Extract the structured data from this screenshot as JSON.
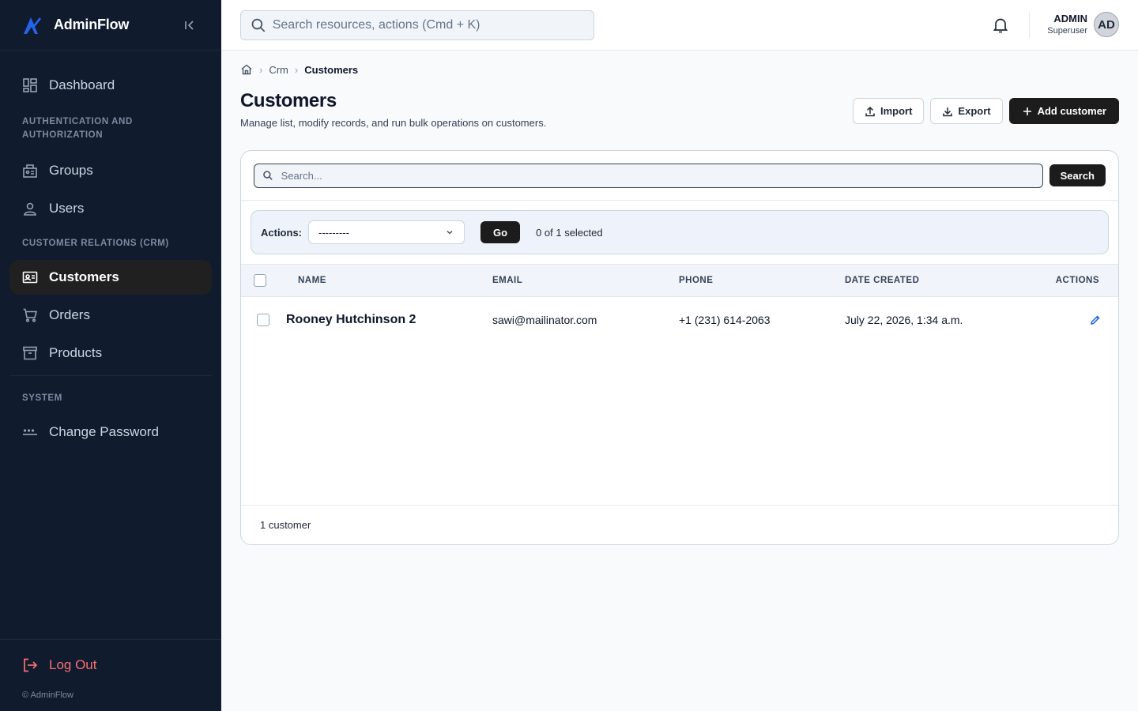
{
  "app": {
    "name": "AdminFlow",
    "copyright": "© AdminFlow"
  },
  "sidebar": {
    "dashboard": "Dashboard",
    "section_auth": "Authentication and Authorization",
    "groups": "Groups",
    "users": "Users",
    "section_crm": "Customer Relations (CRM)",
    "customers": "Customers",
    "orders": "Orders",
    "products": "Products",
    "section_system": "System",
    "change_password": "Change Password",
    "logout": "Log Out"
  },
  "topbar": {
    "search_placeholder": "Search resources, actions (Cmd + K)",
    "user_name": "ADMIN",
    "user_role": "Superuser",
    "avatar_initials": "AD"
  },
  "breadcrumb": {
    "level1": "Crm",
    "current": "Customers",
    "separator": "›"
  },
  "page": {
    "title": "Customers",
    "subtitle": "Manage list, modify records, and run bulk operations on customers.",
    "import_label": "Import",
    "export_label": "Export",
    "add_label": "Add customer"
  },
  "list": {
    "search_placeholder": "Search...",
    "search_button": "Search",
    "actions_label": "Actions:",
    "actions_selected": "---------",
    "go_button": "Go",
    "selected_count": "0 of 1 selected",
    "columns": {
      "name": "NAME",
      "email": "EMAIL",
      "phone": "PHONE",
      "date": "DATE CREATED",
      "actions": "ACTIONS"
    },
    "rows": [
      {
        "name": "Rooney Hutchinson 2",
        "email": "sawi@mailinator.com",
        "phone": "+1 (231) 614-2063",
        "date": "July 22, 2026, 1:34 a.m."
      }
    ],
    "footer": "1 customer"
  },
  "colors": {
    "sidebar_bg": "#111b2e",
    "accent_blue": "#2563eb",
    "logout_red": "#f87171",
    "dark_button": "#1c1c1c"
  }
}
